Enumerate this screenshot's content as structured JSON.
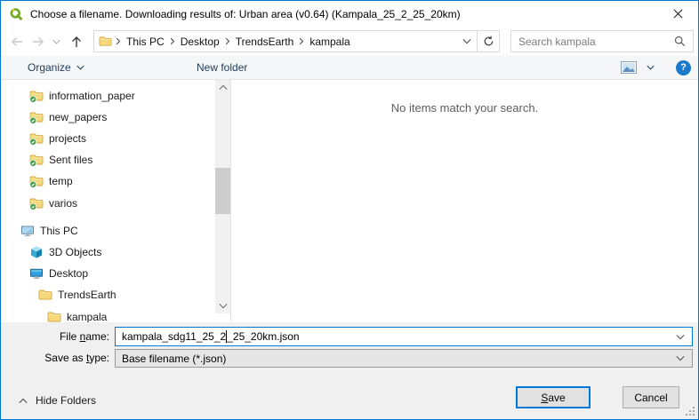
{
  "window": {
    "title": "Choose a filename. Downloading results of: Urban area (v0.64) (Kampala_25_2_25_20km)"
  },
  "address_bar": {
    "breadcrumb": [
      "This PC",
      "Desktop",
      "TrendsEarth",
      "kampala"
    ],
    "search_placeholder": "Search kampala"
  },
  "toolbar": {
    "organize_label": "Organize",
    "new_folder_label": "New folder",
    "help_glyph": "?"
  },
  "sidebar": {
    "items": [
      {
        "label": "information_paper",
        "icon": "folder-synced"
      },
      {
        "label": "new_papers",
        "icon": "folder-synced"
      },
      {
        "label": "projects",
        "icon": "folder-synced"
      },
      {
        "label": "Sent files",
        "icon": "folder-synced"
      },
      {
        "label": "temp",
        "icon": "folder-synced"
      },
      {
        "label": "varios",
        "icon": "folder-synced"
      },
      {
        "label": "This PC",
        "icon": "computer"
      },
      {
        "label": "3D Objects",
        "icon": "cube-3d"
      },
      {
        "label": "Desktop",
        "icon": "desktop"
      },
      {
        "label": "TrendsEarth",
        "icon": "folder"
      },
      {
        "label": "kampala",
        "icon": "folder"
      }
    ]
  },
  "main": {
    "empty_message": "No items match your search."
  },
  "form": {
    "file_name_label": {
      "pre": "File ",
      "accel": "n",
      "post": "ame:"
    },
    "file_name_value": "kampala_sdg11_25_2_25_20km.json",
    "file_name_before_caret": "kampala_sdg11_25_2",
    "file_name_after_caret": "_25_20km.json",
    "save_as_type_label": {
      "pre": "Save as ",
      "accel": "t",
      "post": "ype:"
    },
    "save_as_type_value": "Base filename (*.json)"
  },
  "footer": {
    "hide_folders_label": "Hide Folders",
    "save_label": {
      "pre": "",
      "accel": "S",
      "post": "ave"
    },
    "cancel_label": "Cancel"
  },
  "colors": {
    "accent": "#0078d7",
    "help_blue": "#1979ca",
    "folder_yellow": "#f6d87a",
    "sync_green": "#43a047"
  }
}
